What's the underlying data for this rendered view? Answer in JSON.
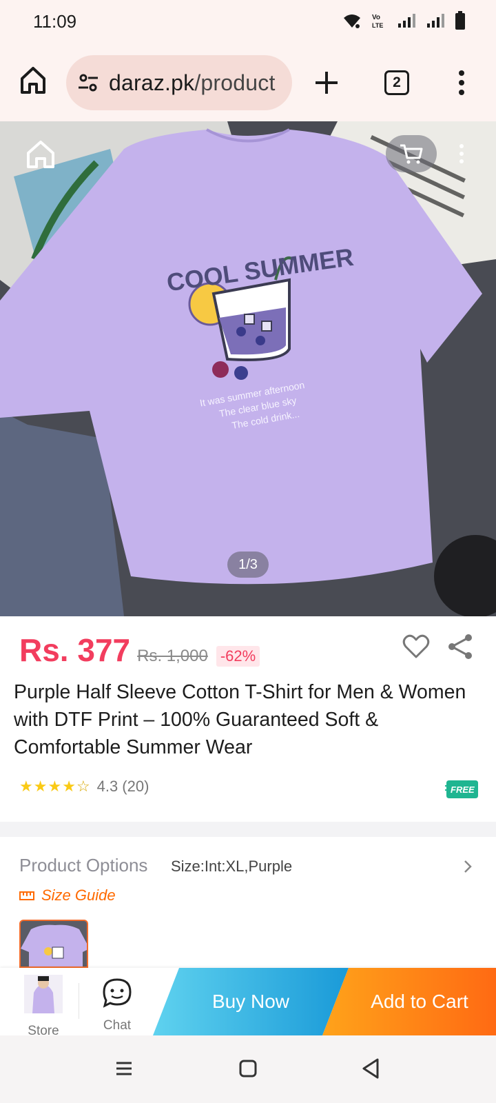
{
  "status_bar": {
    "time": "11:09",
    "network_label": "Vo LTE"
  },
  "browser": {
    "url_host": "daraz.pk",
    "url_path": "/product",
    "tab_count": "2"
  },
  "image": {
    "counter": "1/3",
    "shirt_print_title": "COOL SUMMER",
    "shirt_print_lines": [
      "It was summer afternoon",
      "The clear blue sky",
      "The cold drink..."
    ]
  },
  "product": {
    "price": "Rs. 377",
    "old_price": "Rs. 1,000",
    "discount": "-62%",
    "title": "Purple Half Sleeve Cotton T-Shirt for Men & Women with DTF Print – 100% Guaranteed Soft & Comfortable Summer Wear",
    "rating": "4.3",
    "rating_count": "(20)",
    "stars_filled": 4.3,
    "free_badge": "FREE"
  },
  "options": {
    "label": "Product Options",
    "value": "Size:Int:XL,Purple",
    "size_guide": "Size Guide"
  },
  "action_bar": {
    "store_label": "Store",
    "chat_label": "Chat",
    "buy_now": "Buy Now",
    "add_to_cart": "Add to Cart"
  },
  "colors": {
    "price": "#f23d5e",
    "accent_orange": "#ff6a00",
    "buy_now": "#1a9ad8",
    "add_to_cart": "#ff6a13",
    "shirt": "#c4b2ec"
  }
}
